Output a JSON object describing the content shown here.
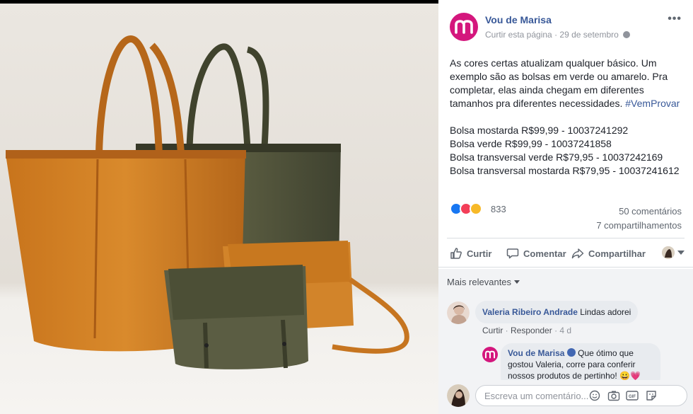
{
  "post": {
    "page_name": "Vou de Marisa",
    "like_page_link": "Curtir esta página",
    "separator": "·",
    "date": "29 de setembro",
    "paragraphs": [
      "As cores certas atualizam qualquer básico. Um exemplo são as bolsas em verde ou amarelo. Pra completar, elas ainda chegam em diferentes tamanhos pra diferentes necessidades."
    ],
    "hashtag": "#VemProvar",
    "items": [
      "Bolsa mostarda R$99,99 - 10037241292",
      "Bolsa verde R$99,99 - 10037241858",
      "Bolsa transversal verde R$79,95 - 10037242169",
      "Bolsa transversal mostarda R$79,95 - 10037241612"
    ],
    "reaction_count": "833",
    "comments_count": "50 comentários",
    "shares_count": "7 compartilhamentos"
  },
  "actions": {
    "like": "Curtir",
    "comment": "Comentar",
    "share": "Compartilhar"
  },
  "comments_section": {
    "sort_label": "Mais relevantes",
    "comments": [
      {
        "author": "Valeria Ribeiro Andrade",
        "text": "Lindas adorei",
        "like_link": "Curtir",
        "reply_link": "Responder",
        "age": "4 d"
      },
      {
        "author": "Vou de Marisa",
        "text_lines": [
          "Que ótimo que",
          "gostou Valeria, corre para conferir",
          "nossos produtos de pertinho! 😀💗"
        ]
      }
    ],
    "compose_placeholder": "Escreva um comentário..."
  },
  "colors": {
    "brand": "#d4177d",
    "link": "#385898",
    "like_blue": "#1877f2",
    "love_red": "#f33e58",
    "wow_yellow": "#f7b928"
  },
  "icons": [
    "more-icon",
    "globe-icon",
    "like-reaction-icon",
    "love-reaction-icon",
    "wow-reaction-icon",
    "thumb-up-icon",
    "comment-icon",
    "share-icon",
    "emoji-icon",
    "camera-icon",
    "gif-icon",
    "sticker-icon"
  ]
}
